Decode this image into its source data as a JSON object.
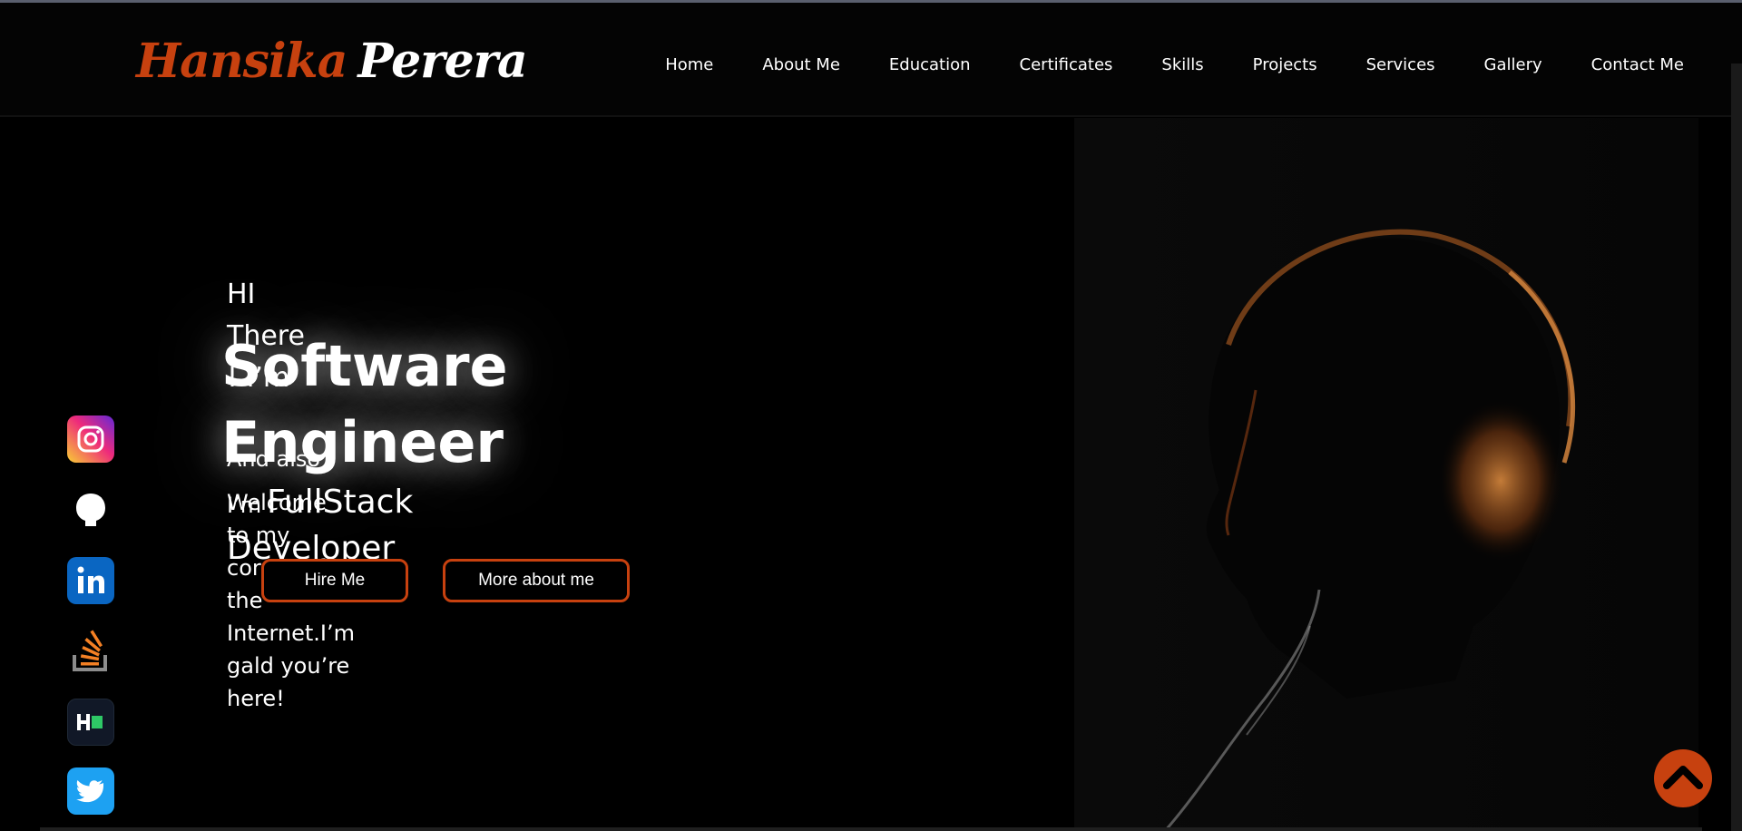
{
  "brand": {
    "first": "Hansika",
    "last": "Perera"
  },
  "nav": {
    "items": [
      "Home",
      "About Me",
      "Education",
      "Certificates",
      "Skills",
      "Projects",
      "Services",
      "Gallery",
      "Contact Me"
    ]
  },
  "hero": {
    "greeting": "HI There ! I’m",
    "title": "Software Engineer",
    "also_prefix": "And also I’m",
    "also_role": "FullStack Developer",
    "welcome": "Welcome to my corner of the Internet.I’m gald you’re here!"
  },
  "buttons": {
    "hire": "Hire Me",
    "more": "More about me"
  },
  "social": [
    "instagram-icon",
    "github-icon",
    "linkedin-icon",
    "stackoverflow-icon",
    "hackerrank-icon",
    "twitter-icon"
  ],
  "colors": {
    "accent": "#c7410f",
    "background": "#000000",
    "text": "#ffffff"
  }
}
